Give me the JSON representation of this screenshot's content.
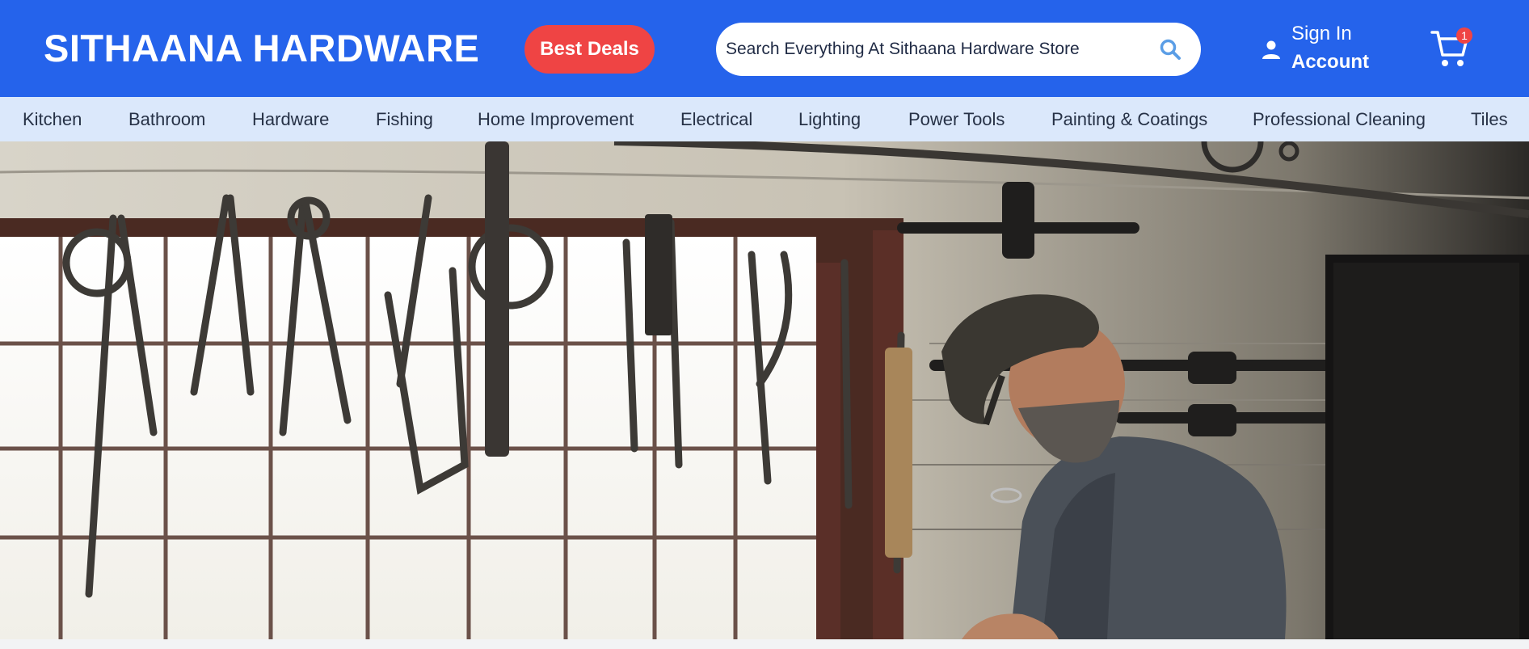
{
  "header": {
    "brand": "SITHAANA HARDWARE",
    "deals_label": "Best Deals",
    "search": {
      "placeholder": "Search Everything At Sithaana Hardware Store"
    },
    "account": {
      "signin_label": "Sign In",
      "account_label": "Account",
      "icon": "user-icon"
    },
    "cart": {
      "count": "1",
      "icon": "cart-icon"
    },
    "colors": {
      "header_bg": "#2563eb",
      "deals_bg": "#ef4444",
      "nav_bg": "#dbe8fb"
    }
  },
  "categories": [
    "Kitchen",
    "Bathroom",
    "Hardware",
    "Fishing",
    "Home Improvement",
    "Electrical",
    "Lighting",
    "Power Tools",
    "Painting & Coatings",
    "Professional Cleaning",
    "Tiles"
  ],
  "hero": {
    "image": "workshop-craftsman-photo"
  }
}
